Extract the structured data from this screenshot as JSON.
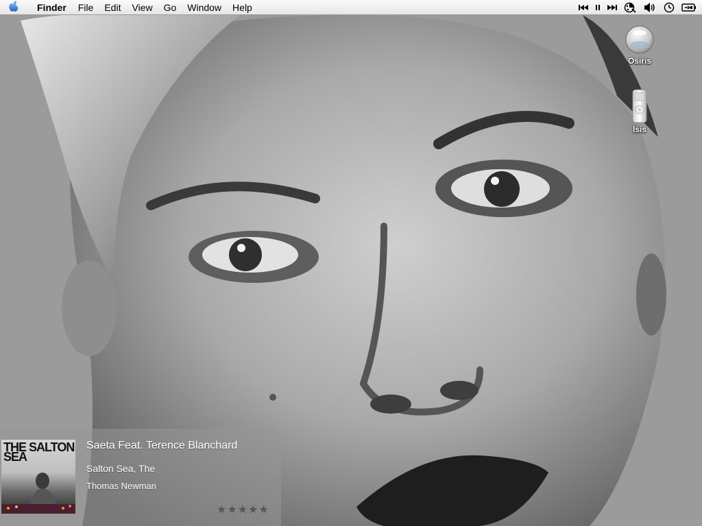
{
  "menubar": {
    "app_name": "Finder",
    "items": [
      "File",
      "Edit",
      "View",
      "Go",
      "Window",
      "Help"
    ],
    "icons": [
      "apple-icon",
      "previous-track-icon",
      "pause-icon",
      "next-track-icon",
      "display-icon",
      "volume-icon",
      "clock-icon",
      "battery-icon"
    ]
  },
  "desktop": {
    "icons": [
      {
        "label": "Osiris",
        "icon": "hard-disk-icon"
      },
      {
        "label": "Isis",
        "icon": "ipod-icon"
      }
    ]
  },
  "now_playing": {
    "track": "Saeta Feat. Terence Blanchard",
    "album": "Salton Sea, The",
    "artist": "Thomas Newman",
    "rating_stars": "★★★★★",
    "album_art_title": "THE SALTON SEA"
  }
}
